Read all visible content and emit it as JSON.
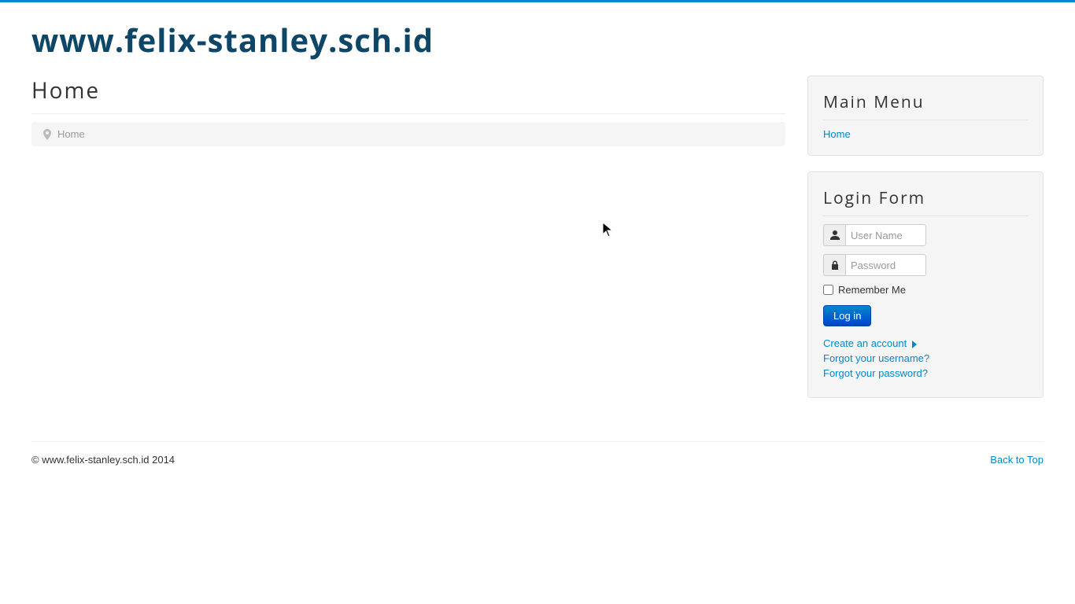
{
  "site": {
    "title": "www.felix-stanley.sch.id"
  },
  "page": {
    "heading": "Home"
  },
  "breadcrumb": {
    "current": "Home"
  },
  "sidebar": {
    "main_menu": {
      "title": "Main Menu",
      "items": [
        {
          "label": "Home"
        }
      ]
    },
    "login": {
      "title": "Login Form",
      "username_placeholder": "User Name",
      "password_placeholder": "Password",
      "remember_label": "Remember Me",
      "login_button": "Log in",
      "links": {
        "create_account": "Create an account",
        "forgot_username": "Forgot your username?",
        "forgot_password": "Forgot your password?"
      }
    }
  },
  "footer": {
    "copyright": "© www.felix-stanley.sch.id 2014",
    "back_to_top": "Back to Top"
  }
}
